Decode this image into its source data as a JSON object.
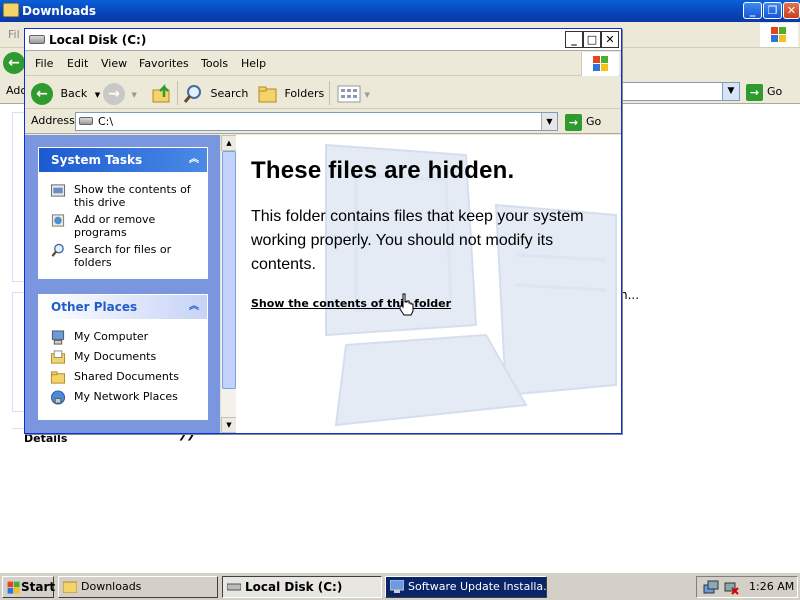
{
  "background_window": {
    "title": "Downloads",
    "menu_partial": "Fil",
    "addr_partial": "Adc",
    "go_label": "Go",
    "details_label": "Details",
    "truncated_text": "n..."
  },
  "window": {
    "title": "Local Disk (C:)",
    "menu": [
      "File",
      "Edit",
      "View",
      "Favorites",
      "Tools",
      "Help"
    ],
    "toolbar": {
      "back": "Back",
      "search": "Search",
      "folders": "Folders"
    },
    "address": {
      "label": "Address",
      "value": "C:\\",
      "go": "Go"
    }
  },
  "tasks": {
    "system_tasks": {
      "title": "System Tasks",
      "items": [
        "Show the contents of this drive",
        "Add or remove programs",
        "Search for files or folders"
      ]
    },
    "other_places": {
      "title": "Other Places",
      "items": [
        "My Computer",
        "My Documents",
        "Shared Documents",
        "My Network Places"
      ]
    }
  },
  "content": {
    "heading": "These files are hidden.",
    "message": "This folder contains files that keep your system working properly. You should not modify its contents.",
    "link": "Show the contents of this folder"
  },
  "taskbar": {
    "start": "Start",
    "tasks": [
      "Downloads",
      "Local Disk (C:)",
      "Software Update Installa..."
    ],
    "clock": "1:26 AM"
  },
  "colors": {
    "title_blue": "#0a5fd8",
    "task_pane": "#7a96df",
    "panel_header": "#1c5ad0",
    "selected_task": "#0a246a"
  }
}
